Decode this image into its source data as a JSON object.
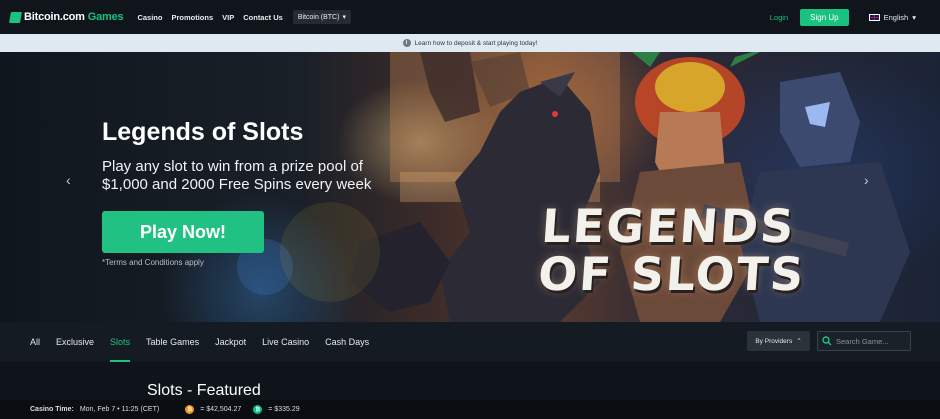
{
  "nav": {
    "logo_brand": "Bitcoin.com",
    "logo_suffix": "Games",
    "links": [
      "Casino",
      "Promotions",
      "VIP",
      "Contact Us"
    ],
    "currency": "Bitcoin (BTC)",
    "login": "Login",
    "signup": "Sign Up",
    "language": "English"
  },
  "infobar": {
    "text": "Learn how to deposit & start playing today!"
  },
  "hero": {
    "title": "Legends of Slots",
    "subtitle": "Play any slot to win from a prize pool of $1,000 and 2000 Free Spins every week",
    "cta": "Play Now!",
    "terms": "*Terms and Conditions apply",
    "art_logo_line1": "LEGENDS",
    "art_logo_line2": "OF SLOTS"
  },
  "tabs": {
    "items": [
      "All",
      "Exclusive",
      "Slots",
      "Table Games",
      "Jackpot",
      "Live Casino",
      "Cash Days"
    ],
    "active": "Slots",
    "providers_label": "By Providers",
    "search_placeholder": "Search Game..."
  },
  "content": {
    "section_title": "Slots - Featured"
  },
  "footer": {
    "casino_time_label": "Casino Time:",
    "casino_time_value": "Mon, Feb 7 • 11:25 (CET)",
    "btc_price": "= $42,504.27",
    "bch_price": "= $335.29"
  },
  "colors": {
    "accent": "#21c184",
    "nav_bg": "#10151b",
    "infobar_bg": "#dfe9f2",
    "tabbar_bg": "#151b22"
  }
}
